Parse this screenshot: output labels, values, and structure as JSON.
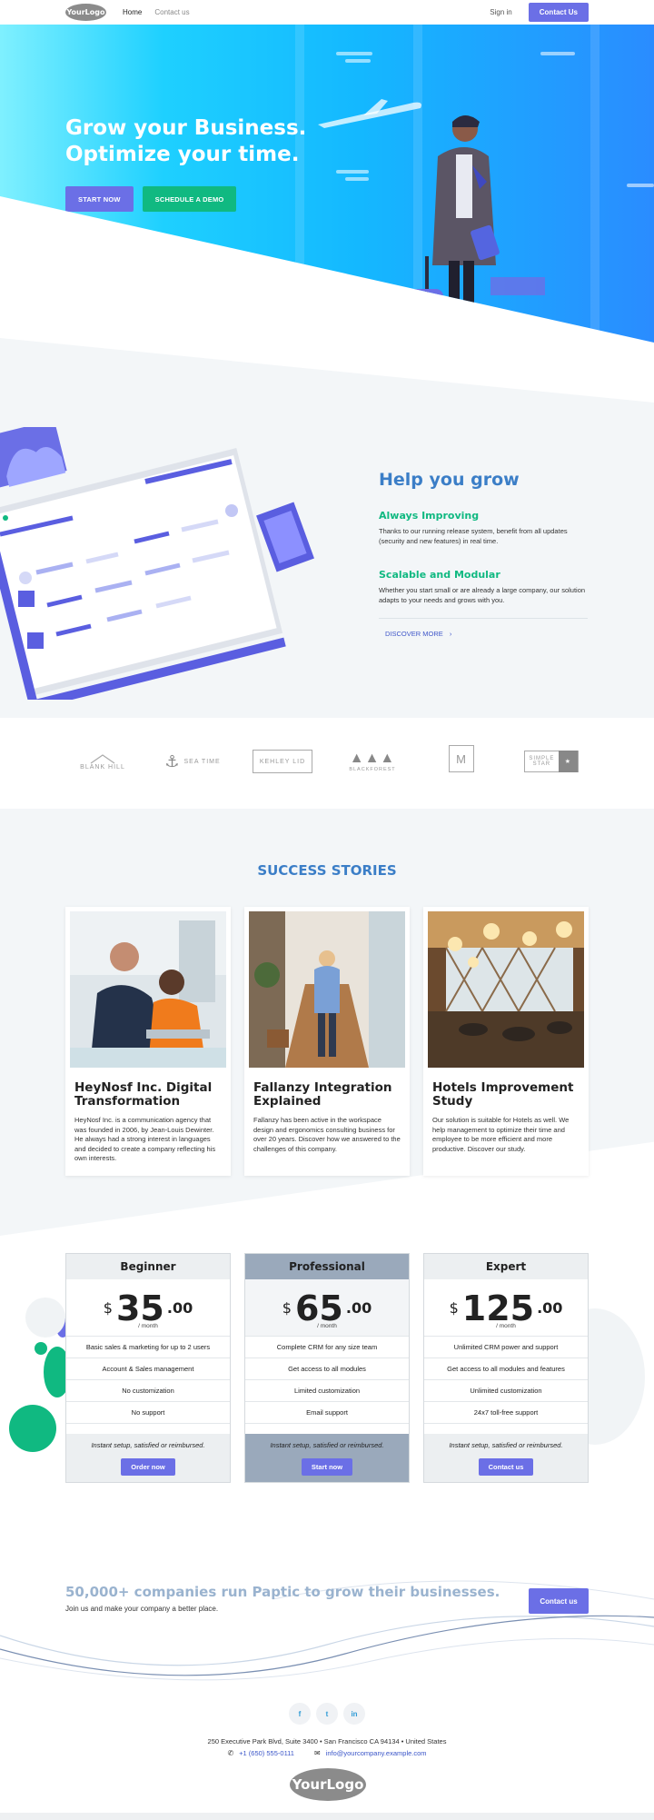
{
  "nav": {
    "logo": "YourLogo",
    "links": [
      "Home",
      "Contact us"
    ],
    "signin": "Sign in",
    "contact_button": "Contact Us"
  },
  "hero": {
    "title_line1": "Grow your Business.",
    "title_line2": "Optimize your time.",
    "btn_start": "START NOW",
    "btn_demo": "SCHEDULE A DEMO"
  },
  "grow": {
    "title": "Help you grow",
    "items": [
      {
        "heading": "Always Improving",
        "text": "Thanks to our running release system, benefit from all updates (security and new features) in real time."
      },
      {
        "heading": "Scalable and Modular",
        "text": "Whether you start small or are already a large company, our solution adapts to your needs and grows with you."
      }
    ],
    "discover": "DISCOVER MORE"
  },
  "logos": [
    "BLANK HILL",
    "SEA TIME",
    "KEHLEY LID",
    "BLACKFOREST",
    "M",
    "SIMPLE STAR"
  ],
  "success": {
    "title": "SUCCESS STORIES",
    "stories": [
      {
        "title": "HeyNosf Inc. Digital Transformation",
        "text": "HeyNosf Inc. is a communication agency that was founded in 2006, by Jean-Louis Dewinter. He always had a strong interest in languages and decided to create a company reflecting his own interests."
      },
      {
        "title": "Fallanzy Integration Explained",
        "text": "Fallanzy has been active in the workspace design and ergonomics consulting business for over 20 years. Discover how we answered to the challenges of this company."
      },
      {
        "title": "Hotels Improvement Study",
        "text": "Our solution is suitable for Hotels as well. We help management to optimize their time and employee to be more efficient and more productive. Discover our study."
      }
    ]
  },
  "pricing": {
    "plans": [
      {
        "name": "Beginner",
        "currency": "$",
        "price": "35",
        "cents": ".00",
        "period": "/ month",
        "features": [
          "Basic sales & marketing for up to 2 users",
          "Account & Sales management",
          "No customization",
          "No support"
        ],
        "note": "Instant setup, satisfied or reimbursed.",
        "button": "Order now",
        "header_bg": "#eceff1",
        "foot_bg": "#eceff1"
      },
      {
        "name": "Professional",
        "currency": "$",
        "price": "65",
        "cents": ".00",
        "period": "/ month",
        "features": [
          "Complete CRM for any size team",
          "Get access to all modules",
          "Limited customization",
          "Email support"
        ],
        "note": "Instant setup, satisfied or reimbursed.",
        "button": "Start now",
        "header_bg": "#9aa9bb",
        "foot_bg": "#9aa9bb"
      },
      {
        "name": "Expert",
        "currency": "$",
        "price": "125",
        "cents": ".00",
        "period": "/ month",
        "features": [
          "Unlimited CRM power and support",
          "Get access to all modules and features",
          "Unlimited customization",
          "24x7 toll-free support"
        ],
        "note": "Instant setup, satisfied or reimbursed.",
        "button": "Contact us",
        "header_bg": "#eceff1",
        "foot_bg": "#eceff1"
      }
    ]
  },
  "cta": {
    "title": "50,000+ companies run Paptic to grow their businesses.",
    "subtitle": "Join us and make your company a better place.",
    "button": "Contact us"
  },
  "footer": {
    "social": [
      "f",
      "t",
      "in"
    ],
    "address": "250 Executive Park Blvd, Suite 3400 • San Francisco CA 94134 • United States",
    "phone": "+1 (650) 555-0111",
    "email": "info@yourcompany.example.com",
    "logo": "YourLogo"
  },
  "colors": {
    "primary": "#6b6fe6",
    "accent_green": "#10b981",
    "heading_blue": "#3b7ec7"
  }
}
